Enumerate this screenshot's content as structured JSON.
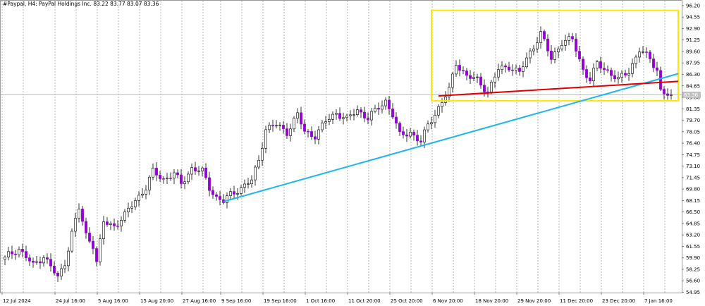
{
  "header": {
    "symbol_label": "#Paypal, H4:  PayPal Holdings Inc.  83.22 83.77 83.07 83.36"
  },
  "price_tag": "83.36",
  "chart_data": {
    "type": "candlestick",
    "ylim": [
      54.9,
      96.9
    ],
    "y_ticks": [
      "96.20",
      "94.55",
      "92.90",
      "91.25",
      "89.60",
      "87.95",
      "86.30",
      "84.65",
      "83.00",
      "81.35",
      "79.70",
      "78.05",
      "76.40",
      "74.75",
      "73.10",
      "71.45",
      "69.80",
      "68.15",
      "66.50",
      "64.85",
      "63.20",
      "61.55",
      "59.90",
      "58.25",
      "56.60",
      "54.95"
    ],
    "x_ticks": [
      {
        "label": "12 Jul 2024",
        "i": 0
      },
      {
        "label": "24 Jul 16:00",
        "i": 15
      },
      {
        "label": "5 Aug 16:00",
        "i": 27
      },
      {
        "label": "15 Aug 20:00",
        "i": 39
      },
      {
        "label": "27 Aug 16:00",
        "i": 51
      },
      {
        "label": "9 Sep 16:00",
        "i": 62
      },
      {
        "label": "19 Sep 16:00",
        "i": 74
      },
      {
        "label": "1 Oct 16:00",
        "i": 86
      },
      {
        "label": "11 Oct 20:00",
        "i": 98
      },
      {
        "label": "25 Oct 20:00",
        "i": 110
      },
      {
        "label": "6 Nov 20:00",
        "i": 122
      },
      {
        "label": "18 Nov 20:00",
        "i": 134
      },
      {
        "label": "29 Nov 20:00",
        "i": 146
      },
      {
        "label": "11 Dec 20:00",
        "i": 158
      },
      {
        "label": "23 Dec 20:00",
        "i": 170
      },
      {
        "label": "7 Jan 16:00",
        "i": 182
      }
    ],
    "bull_color": "#ffffff",
    "bear_color": "#9400d3",
    "n_bars": 190,
    "anchors": [
      [
        0,
        60.0
      ],
      [
        4,
        61.2
      ],
      [
        8,
        58.8
      ],
      [
        11,
        60.2
      ],
      [
        15,
        57.0
      ],
      [
        17,
        59.2
      ],
      [
        19,
        63.5
      ],
      [
        21,
        67.0
      ],
      [
        23,
        63.2
      ],
      [
        25,
        61.8
      ],
      [
        26,
        59.3
      ],
      [
        28,
        65.0
      ],
      [
        31,
        64.5
      ],
      [
        34,
        66.0
      ],
      [
        37,
        68.2
      ],
      [
        40,
        70.0
      ],
      [
        42,
        72.3
      ],
      [
        45,
        71.2
      ],
      [
        48,
        72.0
      ],
      [
        50,
        70.5
      ],
      [
        53,
        72.8
      ],
      [
        56,
        72.3
      ],
      [
        58,
        70.0
      ],
      [
        60,
        68.6
      ],
      [
        62,
        68.0
      ],
      [
        64,
        69.0
      ],
      [
        67,
        70.0
      ],
      [
        70,
        71.0
      ],
      [
        72,
        74.0
      ],
      [
        74,
        78.5
      ],
      [
        77,
        79.0
      ],
      [
        80,
        78.0
      ],
      [
        83,
        80.5
      ],
      [
        85,
        78.0
      ],
      [
        88,
        77.5
      ],
      [
        91,
        79.5
      ],
      [
        94,
        80.8
      ],
      [
        97,
        79.8
      ],
      [
        100,
        81.2
      ],
      [
        103,
        80.0
      ],
      [
        106,
        81.5
      ],
      [
        108,
        82.5
      ],
      [
        110,
        80.5
      ],
      [
        112,
        77.5
      ],
      [
        115,
        78.0
      ],
      [
        118,
        76.5
      ],
      [
        120,
        79.0
      ],
      [
        123,
        81.5
      ],
      [
        126,
        84.0
      ],
      [
        128,
        88.0
      ],
      [
        131,
        86.0
      ],
      [
        134,
        85.5
      ],
      [
        137,
        83.8
      ],
      [
        140,
        87.0
      ],
      [
        143,
        87.5
      ],
      [
        146,
        86.5
      ],
      [
        149,
        89.5
      ],
      [
        152,
        92.2
      ],
      [
        155,
        88.5
      ],
      [
        158,
        91.0
      ],
      [
        161,
        91.3
      ],
      [
        164,
        87.0
      ],
      [
        166,
        85.5
      ],
      [
        168,
        87.8
      ],
      [
        171,
        86.8
      ],
      [
        174,
        85.5
      ],
      [
        177,
        86.8
      ],
      [
        180,
        89.8
      ],
      [
        183,
        88.5
      ],
      [
        185,
        87.0
      ],
      [
        186,
        84.0
      ],
      [
        188,
        83.3
      ],
      [
        189,
        83.36
      ]
    ],
    "trendlines": [
      {
        "name": "support",
        "color": "#1eb4ee",
        "width": 2,
        "i1": 62,
        "y1": 68.0,
        "i2": 191,
        "y2": 86.4
      },
      {
        "name": "resistance",
        "color": "#e00000",
        "width": 2,
        "i1": 123,
        "y1": 83.2,
        "i2": 191,
        "y2": 85.3
      }
    ],
    "rectangle": {
      "color": "#ffe600",
      "i1": 121,
      "y1": 95.5,
      "i2": 191,
      "y2": 82.5
    },
    "current_price": 83.36
  }
}
